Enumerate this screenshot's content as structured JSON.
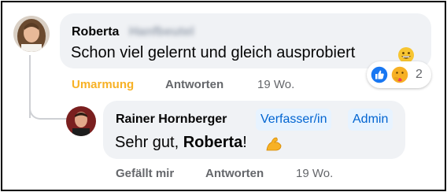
{
  "comment": {
    "author": "Roberta",
    "author_surname_redacted": "Hanfbeutel",
    "text": "Schon viel gelernt und gleich ausprobiert",
    "emoji": "grinning-face",
    "actions": {
      "reaction": "Umarmung",
      "reply": "Antworten",
      "time": "19 Wo."
    },
    "reaction_count": "2",
    "reaction_colors": {
      "like": "#1877f2",
      "care": "#f7b125"
    }
  },
  "reply": {
    "author": "Rainer Hornberger",
    "badges": [
      "Verfasser/in",
      "Admin"
    ],
    "text_prefix": "Sehr gut, ",
    "text_mention": "Roberta",
    "text_suffix": "!",
    "emoji": "flexed-biceps",
    "actions": {
      "like": "Gefällt mir",
      "reply": "Antworten",
      "time": "19 Wo."
    }
  }
}
